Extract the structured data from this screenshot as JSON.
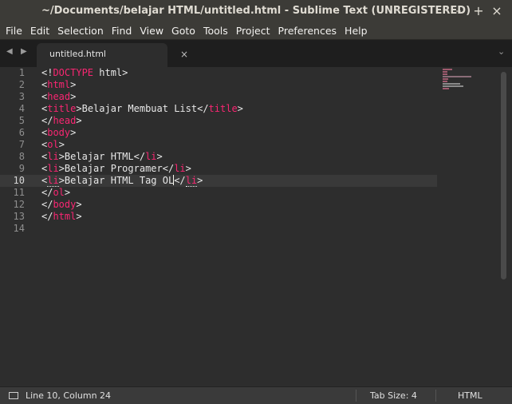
{
  "window": {
    "title": "~/Documents/belajar HTML/untitled.html - Sublime Text (UNREGISTERED)",
    "min_glyph": "–",
    "max_glyph": "+",
    "close_glyph": "×"
  },
  "menu": [
    "File",
    "Edit",
    "Selection",
    "Find",
    "View",
    "Goto",
    "Tools",
    "Project",
    "Preferences",
    "Help"
  ],
  "tabs": [
    {
      "label": "untitled.html",
      "close": "×"
    }
  ],
  "nav": {
    "left": "◀",
    "right": "▶",
    "more": "⌄"
  },
  "editor": {
    "current_line": 10,
    "lines": [
      [
        [
          "p",
          "<!"
        ],
        [
          "t",
          "DOCTYPE"
        ],
        [
          "x",
          " html>"
        ]
      ],
      [
        [
          "p",
          "<"
        ],
        [
          "t",
          "html"
        ],
        [
          "p",
          ">"
        ]
      ],
      [
        [
          "p",
          "<"
        ],
        [
          "t",
          "head"
        ],
        [
          "p",
          ">"
        ]
      ],
      [
        [
          "p",
          "<"
        ],
        [
          "t",
          "title"
        ],
        [
          "p",
          ">"
        ],
        [
          "x",
          "Belajar Membuat List"
        ],
        [
          "p",
          "</"
        ],
        [
          "t",
          "title"
        ],
        [
          "p",
          ">"
        ]
      ],
      [
        [
          "p",
          "</"
        ],
        [
          "t",
          "head"
        ],
        [
          "p",
          ">"
        ]
      ],
      [
        [
          "p",
          "<"
        ],
        [
          "t",
          "body"
        ],
        [
          "p",
          ">"
        ]
      ],
      [
        [
          "p",
          "<"
        ],
        [
          "t",
          "ol"
        ],
        [
          "p",
          ">"
        ]
      ],
      [
        [
          "p",
          "<"
        ],
        [
          "t",
          "li"
        ],
        [
          "p",
          ">"
        ],
        [
          "x",
          "Belajar HTML"
        ],
        [
          "p",
          "</"
        ],
        [
          "t",
          "li"
        ],
        [
          "p",
          ">"
        ]
      ],
      [
        [
          "p",
          "<"
        ],
        [
          "t",
          "li"
        ],
        [
          "p",
          ">"
        ],
        [
          "x",
          "Belajar Programer"
        ],
        [
          "p",
          "</"
        ],
        [
          "t",
          "li"
        ],
        [
          "p",
          ">"
        ]
      ],
      [
        [
          "p",
          "<"
        ],
        [
          "m",
          "li"
        ],
        [
          "p",
          ">"
        ],
        [
          "x",
          "Belajar HTML Tag OL"
        ],
        [
          "c",
          ""
        ],
        [
          "p",
          "</"
        ],
        [
          "m",
          "li"
        ],
        [
          "p",
          ">"
        ]
      ],
      [
        [
          "p",
          "</"
        ],
        [
          "t",
          "ol"
        ],
        [
          "p",
          ">"
        ]
      ],
      [
        [
          "p",
          "</"
        ],
        [
          "t",
          "body"
        ],
        [
          "p",
          ">"
        ]
      ],
      [
        [
          "p",
          "</"
        ],
        [
          "t",
          "html"
        ],
        [
          "p",
          ">"
        ]
      ],
      []
    ]
  },
  "status": {
    "position": "Line 10, Column 24",
    "tab_size": "Tab Size: 4",
    "syntax": "HTML"
  },
  "colors": {
    "tag": "#f92672",
    "text": "#e8e8e8",
    "background": "#2d2d2d"
  }
}
